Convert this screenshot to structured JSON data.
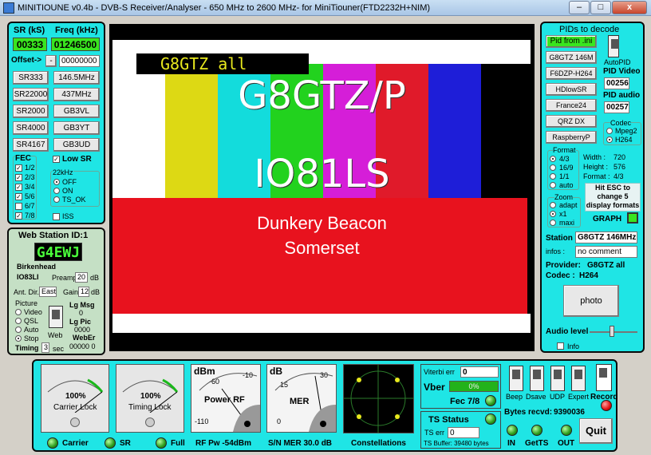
{
  "window": {
    "title": "MINITIOUNE v0.4b  - DVB-S Receiver/Analyser - 650 MHz to 2600 MHz- for MiniTiouner(FTD2232H+NIM)",
    "minimize": "–",
    "maximize": "□",
    "close": "x"
  },
  "left": {
    "sr_header": "SR (kS)",
    "freq_header": "Freq (kHz)",
    "sr_value": "00333",
    "freq_value": "01246500",
    "offset_label": "Offset->",
    "offset_minus": "-",
    "offset_value": "00000000",
    "sr_buttons": [
      "SR333",
      "SR22000",
      "SR2000",
      "SR4000",
      "SR4167"
    ],
    "freq_buttons": [
      "146.5MHz",
      "437MHz",
      "GB3VL",
      "GB3YT",
      "GB3UD"
    ],
    "fec_label": "FEC",
    "fec_options": [
      {
        "label": "1/2",
        "checked": true
      },
      {
        "label": "2/3",
        "checked": true
      },
      {
        "label": "3/4",
        "checked": true
      },
      {
        "label": "5/6",
        "checked": true
      },
      {
        "label": "6/7",
        "checked": false
      },
      {
        "label": "7/8",
        "checked": true
      }
    ],
    "low_sr": "Low SR",
    "khz_label": "22kHz",
    "khz_options": [
      {
        "label": "OFF",
        "selected": true
      },
      {
        "label": "ON",
        "selected": false
      },
      {
        "label": "TS_OK",
        "selected": false
      }
    ],
    "iss": "ISS"
  },
  "web": {
    "title": "Web Station ID:1",
    "callsign_display": "G4EWJ",
    "location": "Birkenhead",
    "locator": "IO83LI",
    "preamp_label": "Preamp",
    "preamp_value": "20",
    "preamp_unit": "dB",
    "antdir_label": "Ant. Dir.",
    "antdir_value": "East",
    "gain_label": "Gain",
    "gain_value": "12",
    "gain_unit": "dB",
    "picture_label": "Picture",
    "picture_options": [
      {
        "label": "Video",
        "selected": false
      },
      {
        "label": "QSL",
        "selected": false
      },
      {
        "label": "Auto",
        "selected": false
      },
      {
        "label": "Stop",
        "selected": true
      }
    ],
    "web_label": "Web",
    "lgmsg_label": "Lg Msg",
    "lgmsg_value": "0",
    "lgpic_label": "Lg Pic",
    "lgpic_value": "0000",
    "weber_label": "WebEr",
    "weber_value": "00000 0",
    "timing_label": "Timing",
    "timing_value": "3",
    "timing_unit": "sec"
  },
  "video": {
    "overlay_call": "G8GTZ all",
    "line1": "G8GTZ/P",
    "line2": "IO81LS",
    "line3": "Dunkery Beacon",
    "line4": "Somerset"
  },
  "right": {
    "title": "PIDs to decode",
    "pid_buttons": [
      "Pid from .ini",
      "G8GTZ 146M",
      "F6DZP-H264",
      "HDlowSR",
      "France24",
      "QRZ DX",
      "RaspberryP"
    ],
    "autopid": "AutoPID",
    "pid_video_label": "PID Video",
    "pid_video": "00256",
    "pid_audio_label": "PID audio",
    "pid_audio": "00257",
    "codec_label": "Codec",
    "codec_options": [
      {
        "label": "Mpeg2",
        "selected": false
      },
      {
        "label": "H264",
        "selected": true
      }
    ],
    "format_label": "Format",
    "format_options": [
      {
        "label": "4/3",
        "selected": true
      },
      {
        "label": "16/9",
        "selected": false
      },
      {
        "label": "1/1",
        "selected": false
      },
      {
        "label": "auto",
        "selected": false
      }
    ],
    "width_label": "Width :",
    "width_value": "720",
    "height_label": "Height :",
    "height_value": "576",
    "fmt_label": "Format :",
    "fmt_value": "4/3",
    "zoom_label": "Zoom",
    "zoom_options": [
      {
        "label": "adapt",
        "selected": false
      },
      {
        "label": "x1",
        "selected": true
      },
      {
        "label": "maxi",
        "selected": false
      }
    ],
    "esc_hint": "Hit ESC to change  5 display formats",
    "graph": "GRAPH",
    "station_label": "Station",
    "station_value": "G8GTZ 146MHz",
    "infos_label": "infos :",
    "infos_value": "no comment",
    "provider_label": "Provider:",
    "provider_value": "G8GTZ all",
    "codec2_label": "Codec :",
    "codec2_value": "H264",
    "photo": "photo",
    "audio_label": "Audio level",
    "info": "Info"
  },
  "bottom": {
    "carrier_pct": "100%",
    "carrier_label": "Carrier Lock",
    "timing_pct": "100%",
    "timing_label": "Timing Lock",
    "power_unit": "dBm",
    "power_ticks": [
      "-60",
      "-10",
      "-110"
    ],
    "power_label": "Power RF",
    "mer_unit": "dB",
    "mer_ticks": [
      "15",
      "30",
      "0"
    ],
    "mer_label": "MER",
    "viterbi_label": "Viterbi err",
    "viterbi_value": "0",
    "vber_label": "Vber",
    "vber_value": "0%",
    "fec_text": "Fec 7/8",
    "ts_status": "TS Status",
    "ts_err_label": "TS err",
    "ts_err_value": "0",
    "ts_buffer": "TS Buffer: 39480 bytes",
    "switches": [
      "Beep",
      "Dsave",
      "UDP",
      "Expert"
    ],
    "record": "Record",
    "bytes_label": "Bytes recvd:",
    "bytes_value": "9390036",
    "led_carrier": "Carrier",
    "led_sr": "SR",
    "led_full": "Full",
    "rf_pw": "RF Pw -54dBm",
    "sn_mer": "S/N MER  30.0 dB",
    "constellations": "Constellations",
    "in": "IN",
    "getts": "GetTS",
    "out": "OUT",
    "quit": "Quit"
  }
}
